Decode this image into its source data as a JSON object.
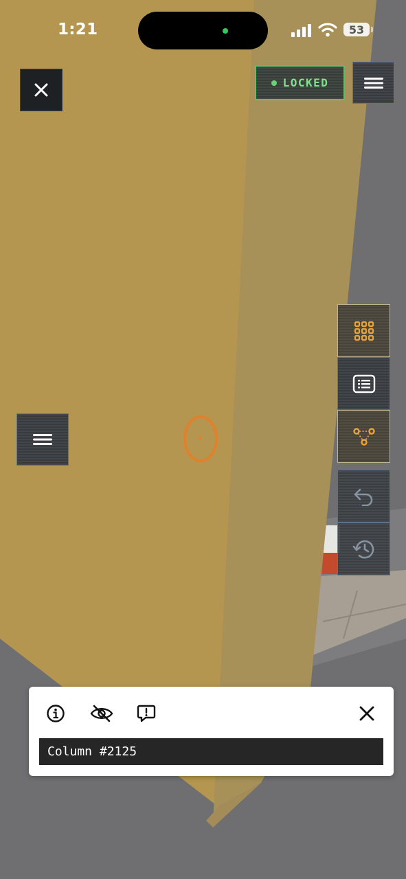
{
  "status_bar": {
    "time": "1:21",
    "battery_level": "53",
    "camera_indicator_color": "#35c759"
  },
  "top_bar": {
    "close_icon": "close-icon",
    "lock_status": "LOCKED",
    "lock_color": "#5fbd6e",
    "menu_icon": "menu-icon"
  },
  "left_panel": {
    "menu_icon": "menu-icon"
  },
  "tool_stack": {
    "accent_color": "#e9a33a",
    "tools": [
      {
        "name": "grid-icon",
        "active": true
      },
      {
        "name": "list-card-icon",
        "active": false
      },
      {
        "name": "connect-points-icon",
        "active": true
      }
    ],
    "history": [
      {
        "name": "undo-icon",
        "enabled": false
      },
      {
        "name": "history-icon",
        "enabled": false
      }
    ]
  },
  "scene": {
    "wall_color": "#b59650",
    "cursor_color": "#e0812c"
  },
  "info_card": {
    "icons": [
      "info-icon",
      "hide-icon",
      "feedback-icon"
    ],
    "close_icon": "close-icon",
    "object_name": "Column #2125"
  }
}
